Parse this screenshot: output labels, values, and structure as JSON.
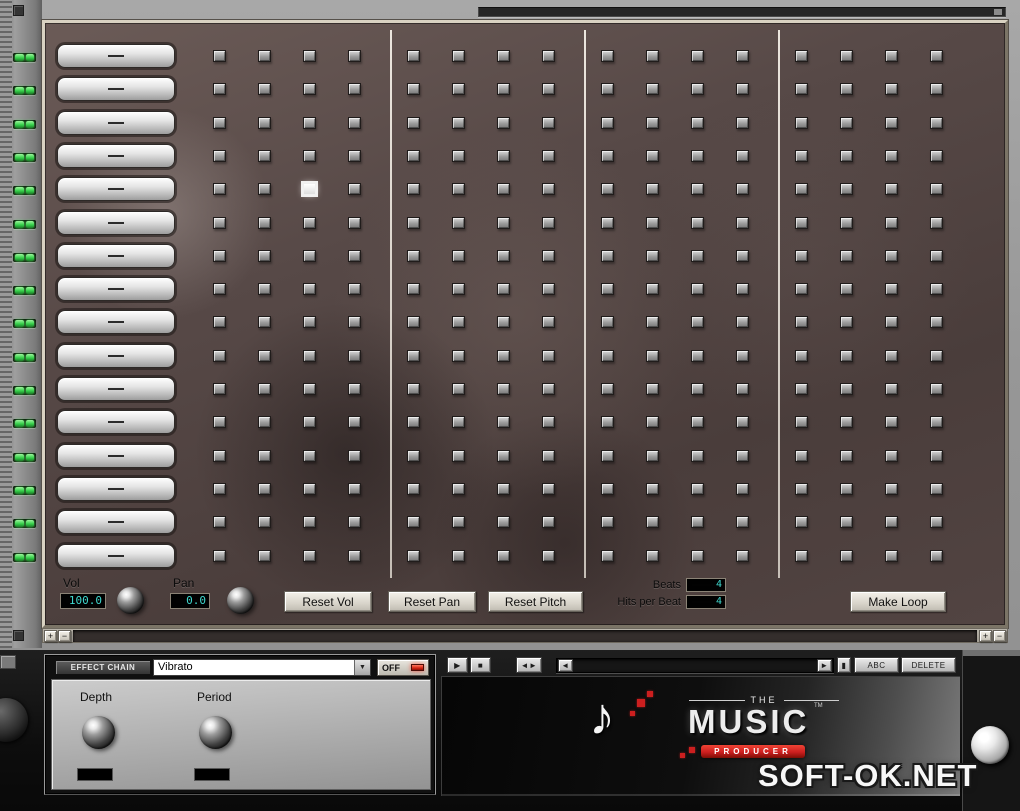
{
  "colors": {
    "led_green": "#35d04a",
    "display_text": "#3fd9cf",
    "producer_red": "#cc1f1f",
    "off_led_red": "#d42312"
  },
  "sequencer": {
    "tracks": 16,
    "groups": 4,
    "steps_per_group": 4,
    "selected_cell": {
      "row": 4,
      "col": 2
    }
  },
  "mixer": {
    "vol_label": "Vol",
    "vol_value": "100.0",
    "pan_label": "Pan",
    "pan_value": "0.0"
  },
  "buttons": {
    "reset_vol": "Reset Vol",
    "reset_pan": "Reset Pan",
    "reset_pitch": "Reset Pitch",
    "make_loop": "Make Loop"
  },
  "loop_settings": {
    "beats_label": "Beats",
    "beats_value": "4",
    "hits_label": "Hits per Beat",
    "hits_value": "4"
  },
  "scrollbar": {
    "plus": "+",
    "minus": "−"
  },
  "effect": {
    "chain_label": "EFFECT CHAIN",
    "selected_effect": "Vibrato",
    "dropdown_arrow": "▼",
    "off_label": "OFF",
    "param1_label": "Depth",
    "param2_label": "Period"
  },
  "transport": {
    "play_label": "▶",
    "stop_label": "■",
    "loop_label": "◄►",
    "prev_label": "◄",
    "next_label": "►",
    "end_label": "▮",
    "abc_label": "ABC",
    "delete_label": "DELETE"
  },
  "logo": {
    "note": "♪",
    "the": "THE",
    "music": "MUSIC",
    "tm": "TM",
    "producer": "PRODUCER"
  },
  "watermark": "SOFT-OK.NET"
}
